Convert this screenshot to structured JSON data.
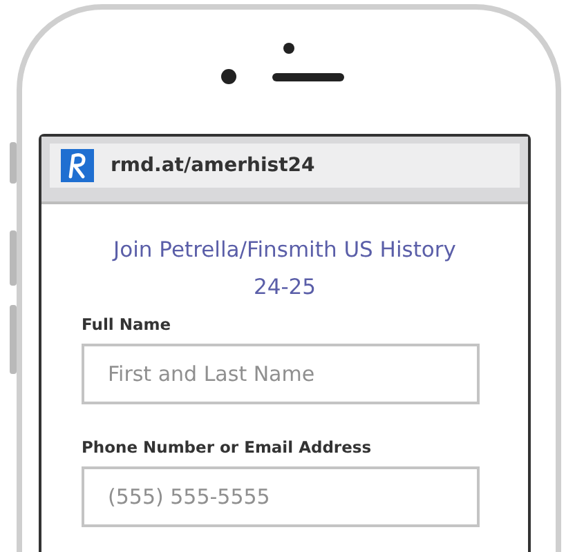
{
  "address_bar": {
    "url": "rmd.at/amerhist24"
  },
  "form": {
    "title": "Join Petrella/Finsmith US History 24-25",
    "fields": [
      {
        "label": "Full Name",
        "placeholder": "First and Last Name"
      },
      {
        "label": "Phone Number or Email Address",
        "placeholder": "(555) 555-5555"
      }
    ]
  }
}
